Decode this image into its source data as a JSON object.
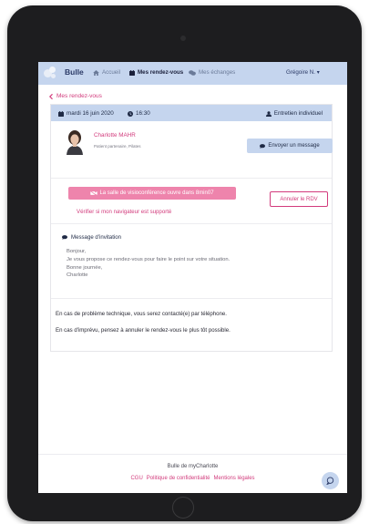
{
  "navbar": {
    "brand": "Bulle",
    "links": {
      "accueil": "Accueil",
      "rdv": "Mes rendez-vous",
      "echanges": "Mes échanges"
    },
    "user": "Grégoire N. ▾"
  },
  "back_link": "Mes rendez-vous",
  "appointment": {
    "date": "mardi 16 juin 2020",
    "time": "16:30",
    "type": "Entretien individuel",
    "partner_name": "Charlotte MAHR",
    "partner_role": "Patient partenaire, Pilates",
    "message_button": "Envoyer un message",
    "visio_button": "La salle de visioconférence ouvre dans 8min07",
    "cancel_button": "Annuler le RDV",
    "check_browser": "Vérifier si mon navigateur est supporté",
    "invitation_title": "Message d'invitation",
    "invitation_lines": [
      "Bonjour,",
      "Je vous propose ce rendez-vous pour faire le point sur votre situation.",
      "Bonne journée,",
      "Charlotte"
    ],
    "info_phone": "En cas de problème technique, vous serez contacté(e) par téléphone.",
    "info_cancel": "En cas d'imprévu, pensez à annuler le rendez-vous le plus tôt possible."
  },
  "footer": {
    "brand_line": "Bulle de myCharlotte",
    "links": [
      "CGU",
      "Politique de confidentialité",
      "Mentions légales"
    ]
  },
  "colors": {
    "accent_pink": "#d23b7c",
    "nav_blue": "#c5d5ee",
    "visio_pink": "#ee84ac"
  },
  "icons": [
    "home-icon",
    "calendar-icon",
    "chat-bubbles-icon",
    "chevron-left-icon",
    "clock-icon",
    "user-icon",
    "speech-bubble-icon",
    "video-off-icon",
    "chat-fab-icon"
  ]
}
